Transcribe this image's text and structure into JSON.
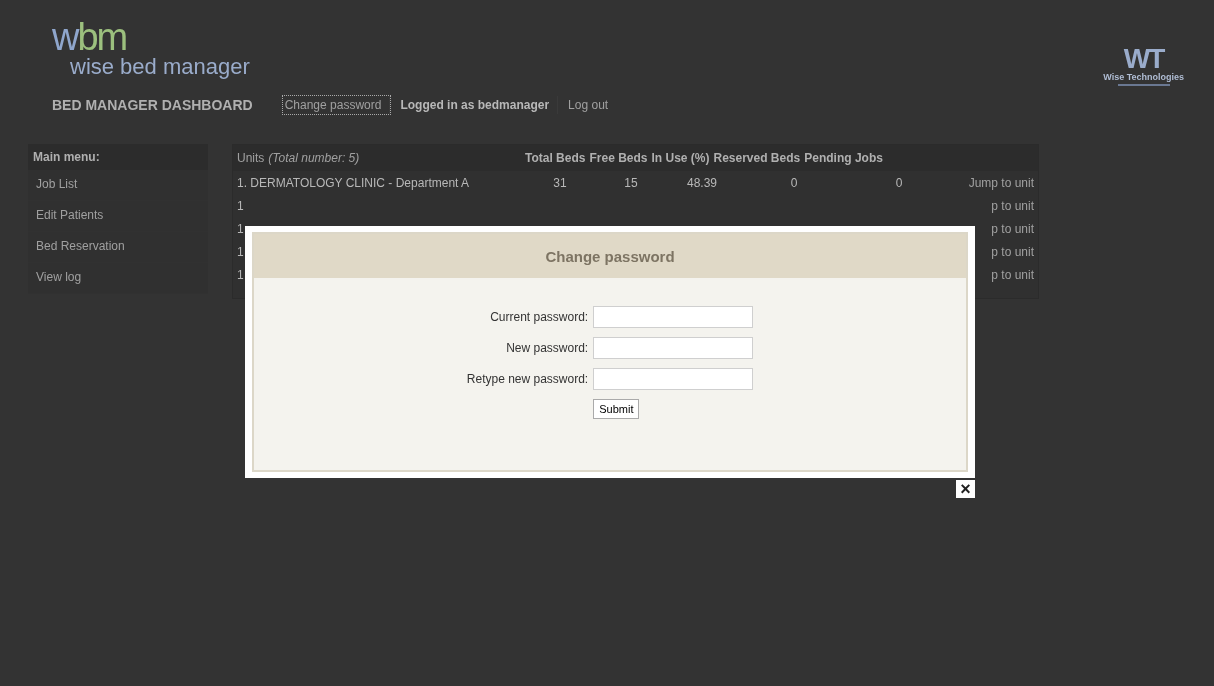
{
  "header": {
    "logo_mark_1": "w",
    "logo_mark_2": "bm",
    "logo_name": "wise bed manager",
    "partner_logo_mark": "WT",
    "partner_logo_name": "Wise Technologies"
  },
  "nav": {
    "title": "BED MANAGER DASHBOARD",
    "links": [
      {
        "label": "Change password",
        "selected": true
      },
      {
        "label": "Logged in as bedmanager",
        "kind": "status",
        "selected": false
      },
      {
        "label": "Log out",
        "selected": false
      }
    ]
  },
  "sidebar": {
    "title": "Main menu:",
    "items": [
      "Job List",
      "Edit Patients",
      "Bed Reservation",
      "View log"
    ]
  },
  "table": {
    "title": "Units",
    "subtitle": "(Total number: 5)",
    "columns": [
      "Total Beds",
      "Free Beds",
      "In Use (%)",
      "Reserved Beds",
      "Pending Jobs"
    ],
    "rows": [
      {
        "unit": "1. DERMATOLOGY CLINIC - Department A",
        "cells": [
          "31",
          "15",
          "48.39",
          "0",
          "0"
        ],
        "action": "Jump to unit"
      },
      {
        "unit": "1",
        "cells": [],
        "action": "p to unit"
      },
      {
        "unit": "1",
        "cells": [],
        "action": "p to unit"
      },
      {
        "unit": "1",
        "cells": [],
        "action": "p to unit"
      },
      {
        "unit": "1",
        "cells": [],
        "action": "p to unit"
      }
    ]
  },
  "dialog": {
    "title": "Change password",
    "fields": [
      {
        "label": "Current password:"
      },
      {
        "label": "New password:"
      },
      {
        "label": "Retype new password:"
      }
    ],
    "submit": "Submit",
    "close": "×"
  }
}
